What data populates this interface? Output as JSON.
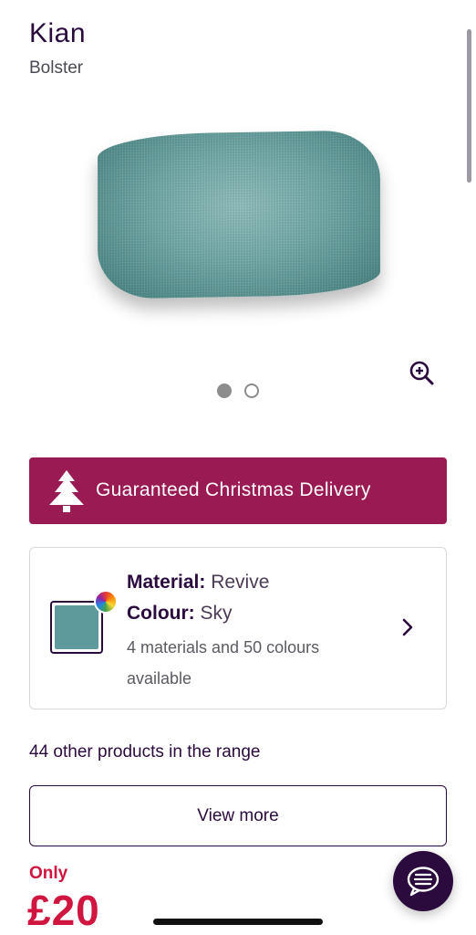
{
  "product": {
    "name": "Kian",
    "type": "Bolster"
  },
  "gallery": {
    "slide_count": 2,
    "active_slide": 1
  },
  "banner": {
    "text": "Guaranteed Christmas Delivery",
    "color": "#9a1a53"
  },
  "material_card": {
    "material_label": "Material:",
    "material_value": "Revive",
    "colour_label": "Colour:",
    "colour_value": "Sky",
    "availability": "4 materials and 50 colours available",
    "swatch_color": "#5e9a9c"
  },
  "range": {
    "text": "44 other products in the range",
    "view_more_label": "View more"
  },
  "price": {
    "prefix": "Only",
    "value": "£20",
    "color": "#d0153f"
  },
  "icons": {
    "zoom": "zoom-in-icon",
    "tree": "christmas-tree-icon",
    "chevron": "chevron-right-icon",
    "chat": "chat-icon"
  }
}
